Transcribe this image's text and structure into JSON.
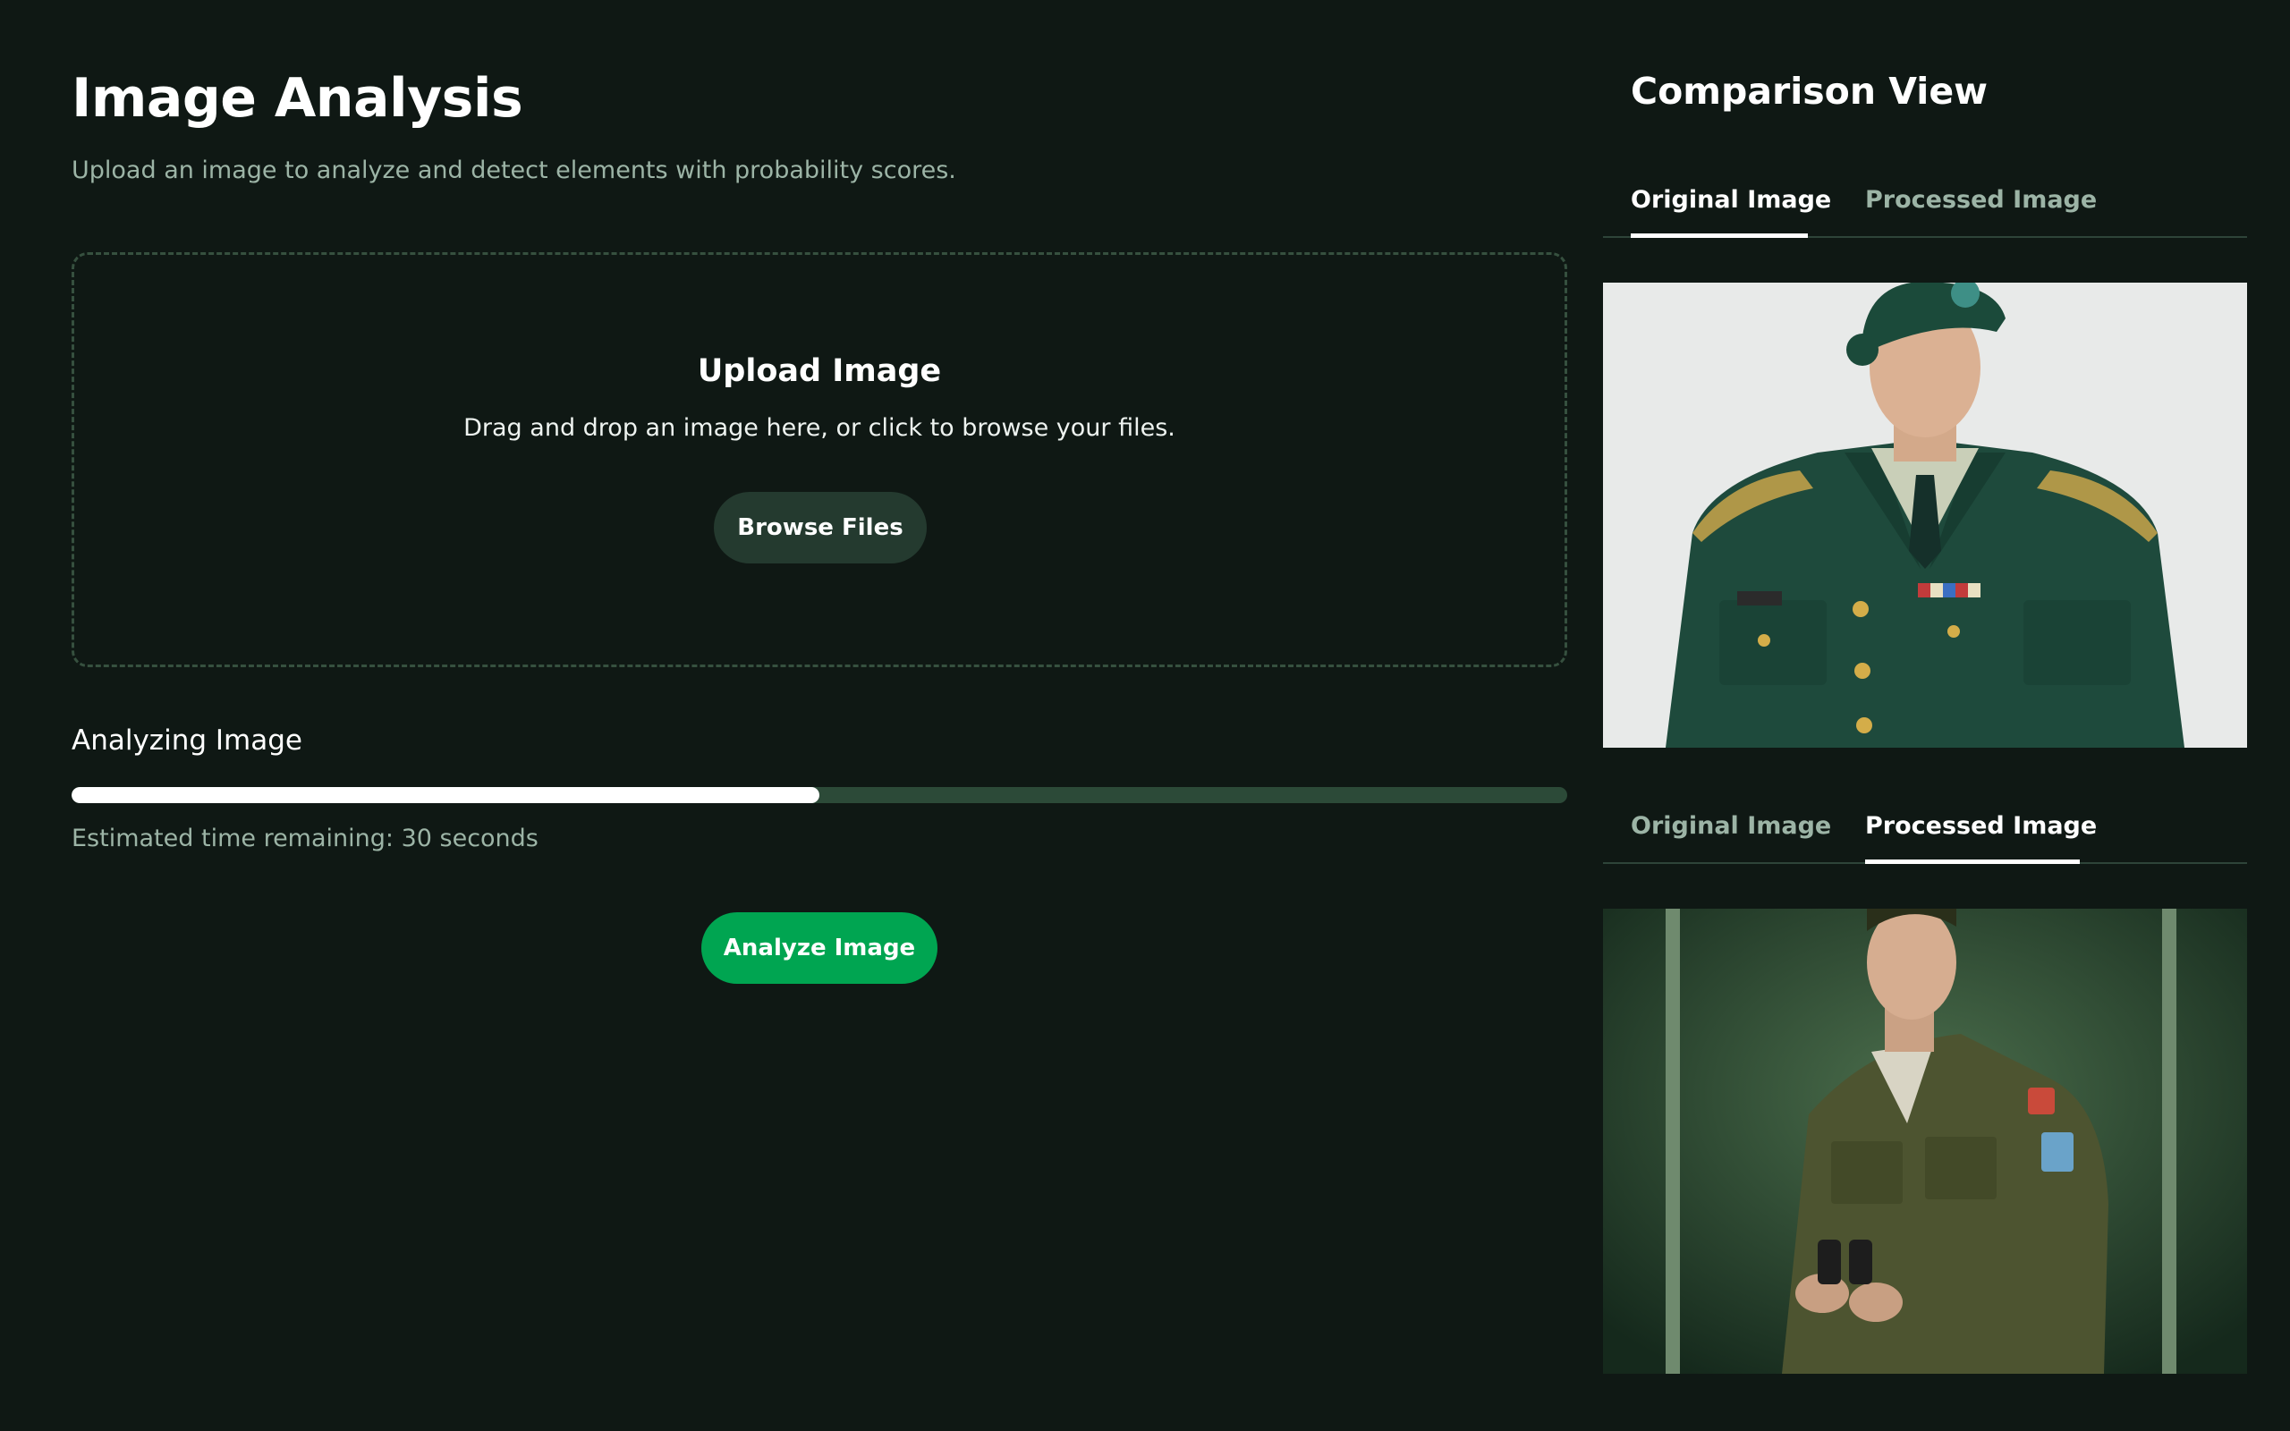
{
  "header": {
    "title": "Image Analysis",
    "subtitle": "Upload an image to analyze and detect elements with probability scores."
  },
  "upload": {
    "title": "Upload Image",
    "description": "Drag and drop an image here, or click to browse your files.",
    "browse_label": "Browse Files"
  },
  "progress": {
    "label": "Analyzing Image",
    "value_percent": 50,
    "time_remaining": "Estimated time remaining: 30 seconds"
  },
  "analyze_label": "Analyze Image",
  "comparison": {
    "title": "Comparison View",
    "panel1": {
      "tabs": [
        {
          "label": "Original Image"
        },
        {
          "label": "Processed Image"
        }
      ],
      "active": "Original Image"
    },
    "panel2": {
      "tabs": [
        {
          "label": "Original Image"
        },
        {
          "label": "Processed Image"
        }
      ],
      "active": "Processed Image"
    }
  },
  "colors": {
    "background": "#0f1814",
    "accent": "#00a551",
    "muted_text": "#9cb4a6",
    "progress_track": "#2c4a38"
  }
}
